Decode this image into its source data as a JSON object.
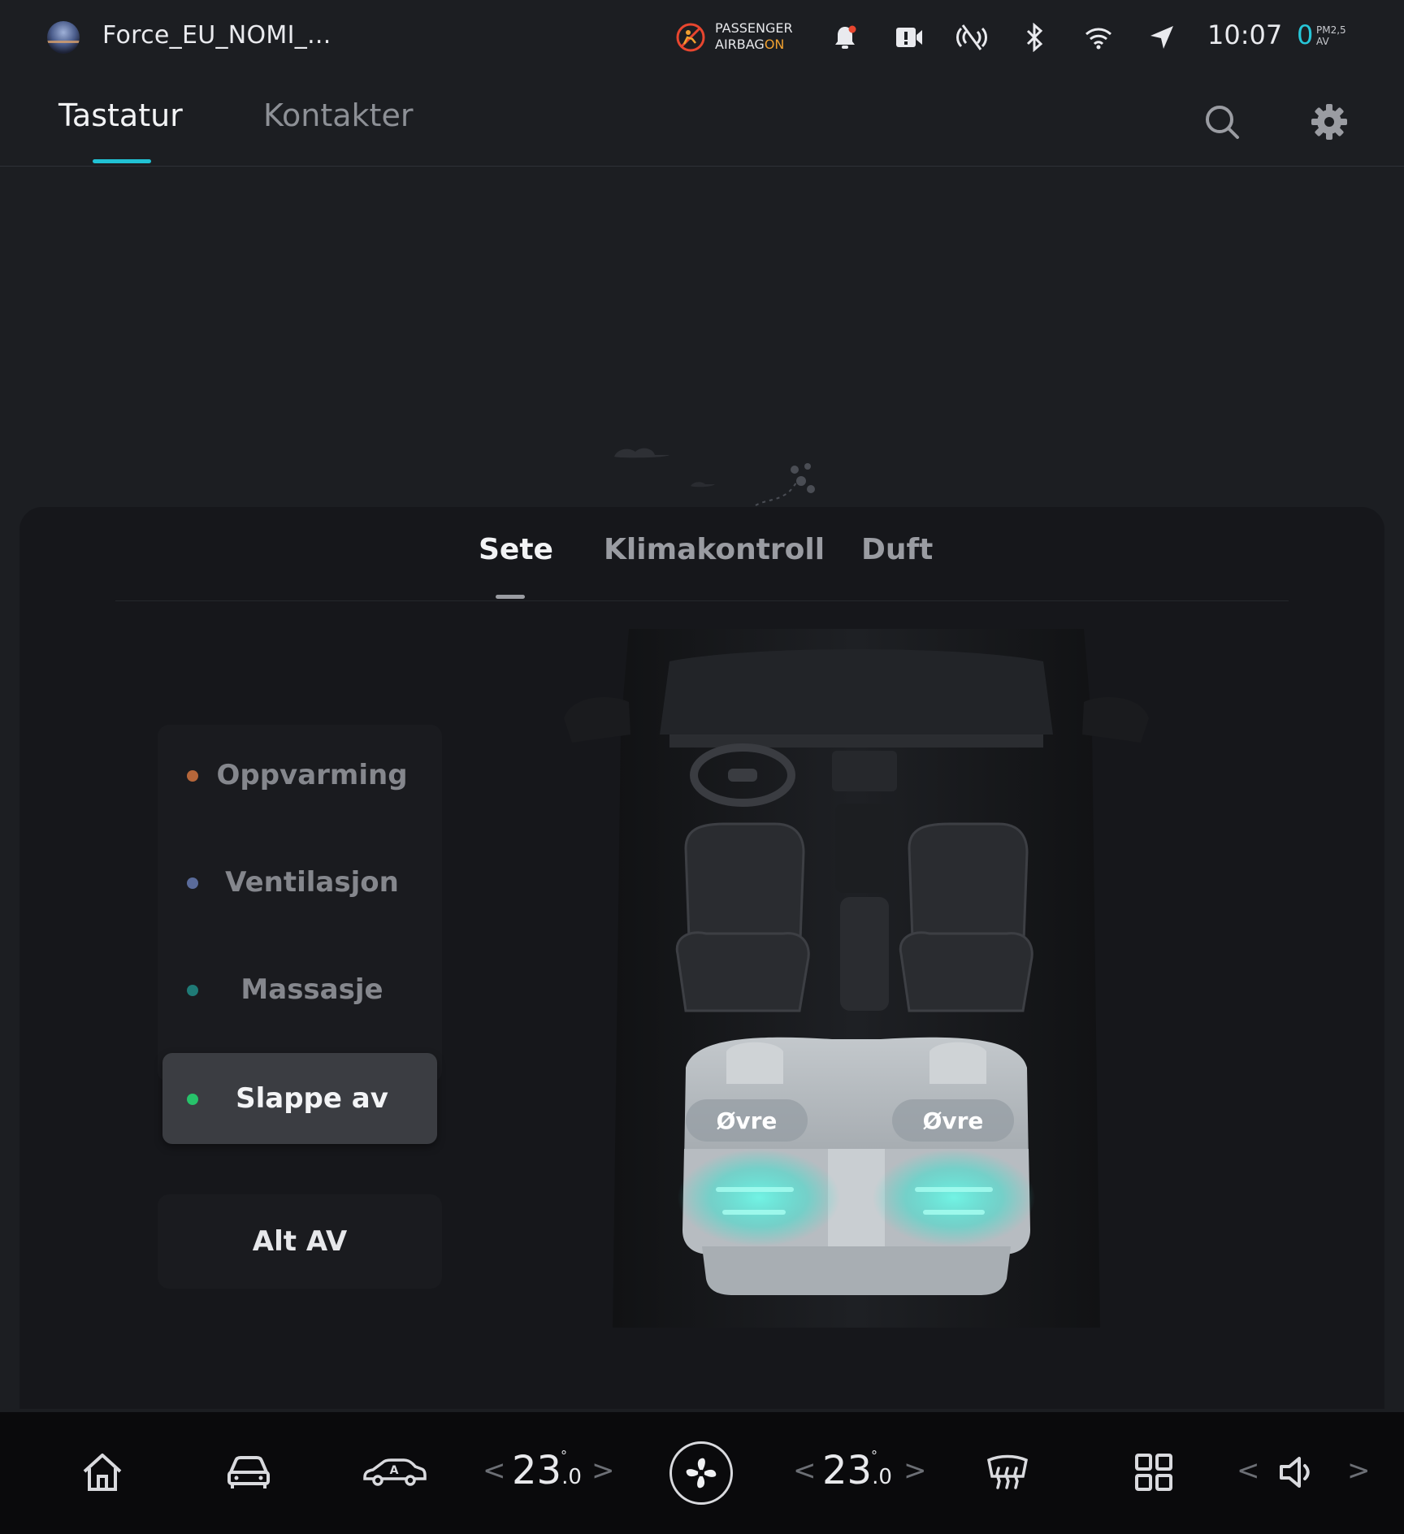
{
  "statusbar": {
    "profile_name": "Force_EU_NOMI_...",
    "airbag_line1": "PASSENGER",
    "airbag_line2": "AIRBAG",
    "airbag_state": "ON",
    "time": "10:07",
    "pm_value": "0",
    "pm_label1": "PM2,5",
    "pm_label2": "AV",
    "icons": [
      "airbag-off-icon",
      "notification-bell-icon",
      "dashcam-icon",
      "nfc-disabled-icon",
      "bluetooth-icon",
      "wifi-icon",
      "navigation-icon"
    ]
  },
  "top_tabs": {
    "items": [
      {
        "label": "Tastatur",
        "active": true
      },
      {
        "label": "Kontakter",
        "active": false
      }
    ],
    "accent_color": "#21c2d4"
  },
  "panel": {
    "tabs": [
      {
        "label": "Sete",
        "active": true
      },
      {
        "label": "Klimakontroll",
        "active": false
      },
      {
        "label": "Duft",
        "active": false
      }
    ],
    "modes": [
      {
        "label": "Oppvarming",
        "dot_color": "#b5663a",
        "selected": false
      },
      {
        "label": "Ventilasjon",
        "dot_color": "#5a6b9a",
        "selected": false
      },
      {
        "label": "Massasje",
        "dot_color": "#1f7a76",
        "selected": false
      },
      {
        "label": "Slappe av",
        "dot_color": "#27c26a",
        "selected": true
      }
    ],
    "all_off_label": "Alt AV",
    "seat_zones": {
      "left_label": "Øvre",
      "right_label": "Øvre",
      "glow_color": "#3fe0cf"
    }
  },
  "dock": {
    "temp_left": "23",
    "temp_left_decimal": ".0",
    "temp_right": "23",
    "temp_right_decimal": ".0",
    "degree_symbol": "°",
    "chevron_left": "<",
    "chevron_right": ">",
    "icons": [
      "home-icon",
      "car-icon",
      "car-assistant-icon",
      "fan-icon",
      "rear-defrost-icon",
      "apps-grid-icon",
      "volume-icon"
    ]
  }
}
